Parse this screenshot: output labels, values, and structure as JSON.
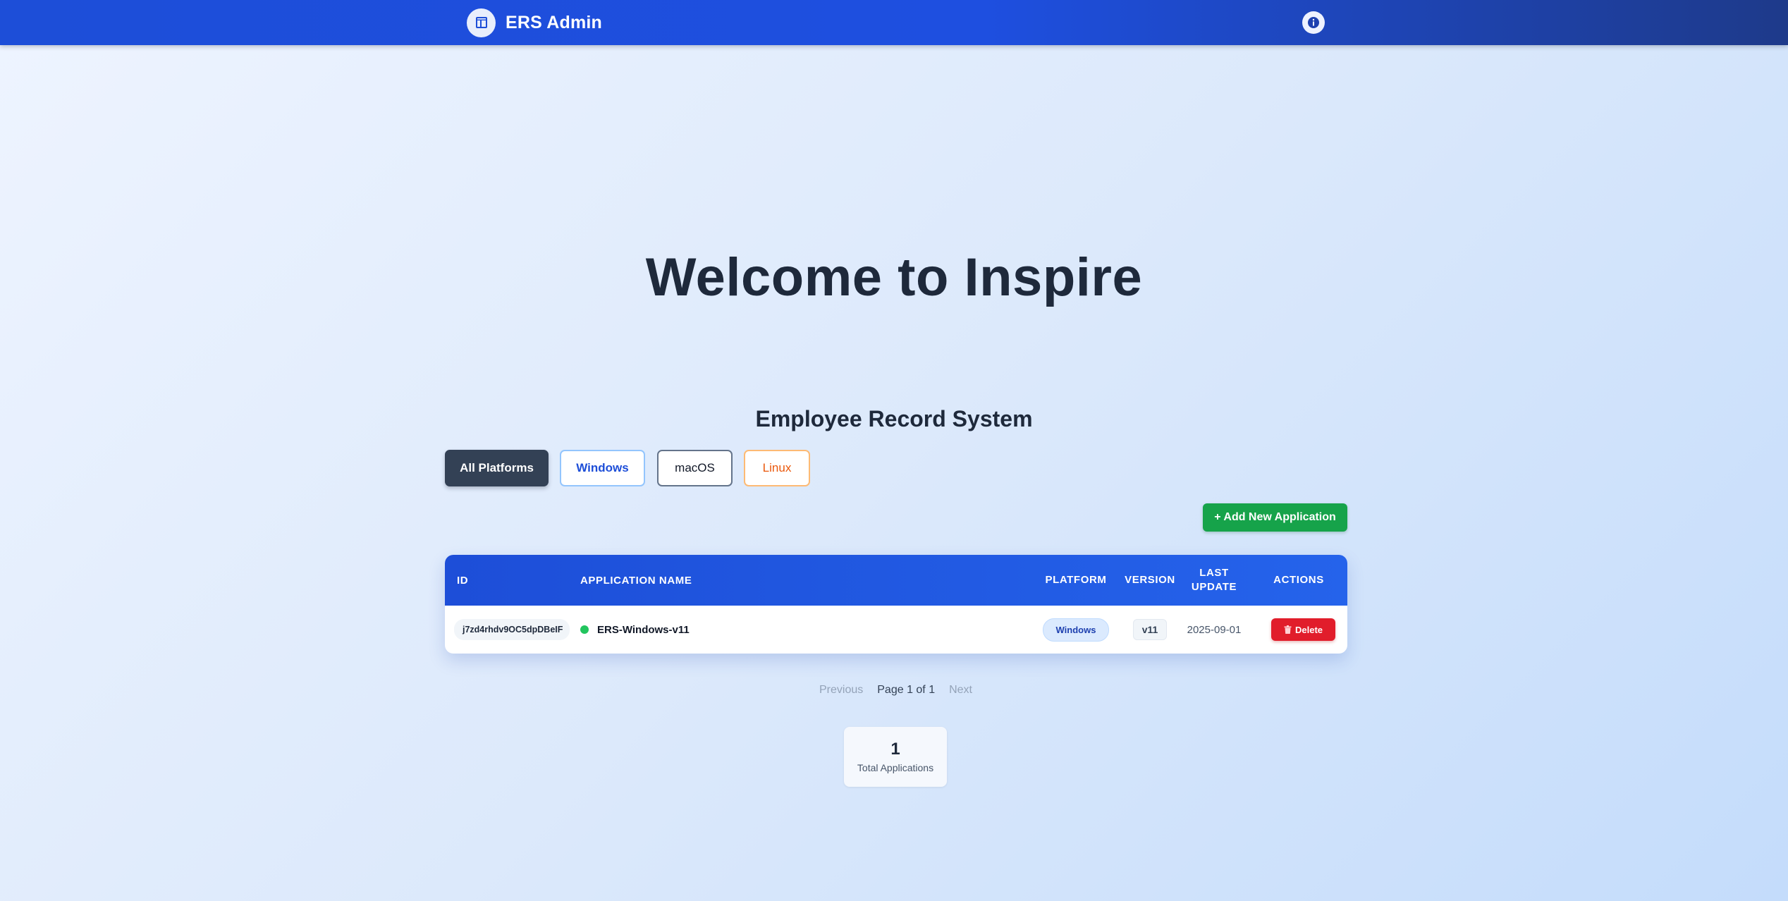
{
  "header": {
    "title": "ERS Admin",
    "logo_icon": "layout-icon",
    "info_icon": "info-icon"
  },
  "hero": {
    "title": "Welcome to Inspire"
  },
  "section": {
    "title": "Employee Record System"
  },
  "filters": [
    {
      "label": "All Platforms",
      "active": true
    },
    {
      "label": "Windows",
      "active": false
    },
    {
      "label": "macOS",
      "active": false
    },
    {
      "label": "Linux",
      "active": false
    }
  ],
  "actions": {
    "add_label": "+ Add New Application"
  },
  "table": {
    "columns": [
      "ID",
      "APPLICATION NAME",
      "PLATFORM",
      "VERSION",
      "LAST UPDATE",
      "ACTIONS"
    ],
    "rows": [
      {
        "id": "j7zd4rhdv9OC5dpDBeIF",
        "name": "ERS-Windows-v11",
        "status_color": "#22c55e",
        "platform": "Windows",
        "version": "v11",
        "last_update": "2025-09-01",
        "action_label": "Delete"
      }
    ]
  },
  "pagination": {
    "prev": "Previous",
    "info": "Page 1 of 1",
    "next": "Next"
  },
  "stats": {
    "total_value": "1",
    "total_label": "Total Applications"
  },
  "colors": {
    "header": "#1d4ed8",
    "primary": "#2563eb",
    "success": "#16a34a",
    "danger": "#e11d2b"
  }
}
